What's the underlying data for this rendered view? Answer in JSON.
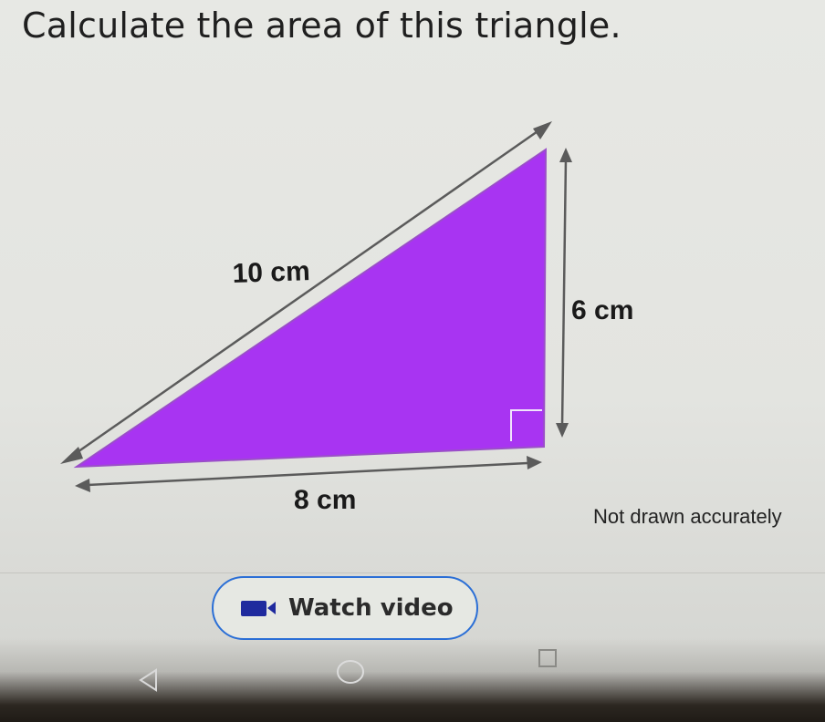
{
  "question": {
    "title": "Calculate the area of this triangle."
  },
  "diagram": {
    "hypotenuse_label": "10 cm",
    "height_label": "6 cm",
    "base_label": "8 cm",
    "fill_color": "#a834f2",
    "note": "Not drawn accurately"
  },
  "video": {
    "button_label": "Watch video",
    "accent_color": "#2b6fd6",
    "icon": "video-camera-icon"
  },
  "navigation": {
    "back_icon": "back-triangle-icon",
    "home_icon": "home-circle-icon",
    "recent_icon": "recent-apps-square-icon"
  }
}
